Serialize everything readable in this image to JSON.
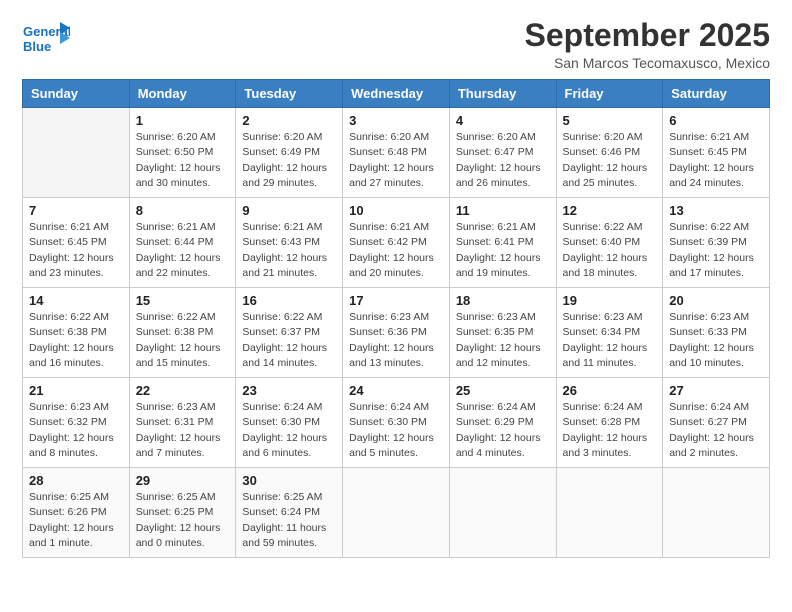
{
  "header": {
    "logo_line1": "General",
    "logo_line2": "Blue",
    "title": "September 2025",
    "subtitle": "San Marcos Tecomaxusco, Mexico"
  },
  "days_of_week": [
    "Sunday",
    "Monday",
    "Tuesday",
    "Wednesday",
    "Thursday",
    "Friday",
    "Saturday"
  ],
  "weeks": [
    [
      {
        "day": "",
        "info": ""
      },
      {
        "day": "1",
        "info": "Sunrise: 6:20 AM\nSunset: 6:50 PM\nDaylight: 12 hours\nand 30 minutes."
      },
      {
        "day": "2",
        "info": "Sunrise: 6:20 AM\nSunset: 6:49 PM\nDaylight: 12 hours\nand 29 minutes."
      },
      {
        "day": "3",
        "info": "Sunrise: 6:20 AM\nSunset: 6:48 PM\nDaylight: 12 hours\nand 27 minutes."
      },
      {
        "day": "4",
        "info": "Sunrise: 6:20 AM\nSunset: 6:47 PM\nDaylight: 12 hours\nand 26 minutes."
      },
      {
        "day": "5",
        "info": "Sunrise: 6:20 AM\nSunset: 6:46 PM\nDaylight: 12 hours\nand 25 minutes."
      },
      {
        "day": "6",
        "info": "Sunrise: 6:21 AM\nSunset: 6:45 PM\nDaylight: 12 hours\nand 24 minutes."
      }
    ],
    [
      {
        "day": "7",
        "info": "Sunrise: 6:21 AM\nSunset: 6:45 PM\nDaylight: 12 hours\nand 23 minutes."
      },
      {
        "day": "8",
        "info": "Sunrise: 6:21 AM\nSunset: 6:44 PM\nDaylight: 12 hours\nand 22 minutes."
      },
      {
        "day": "9",
        "info": "Sunrise: 6:21 AM\nSunset: 6:43 PM\nDaylight: 12 hours\nand 21 minutes."
      },
      {
        "day": "10",
        "info": "Sunrise: 6:21 AM\nSunset: 6:42 PM\nDaylight: 12 hours\nand 20 minutes."
      },
      {
        "day": "11",
        "info": "Sunrise: 6:21 AM\nSunset: 6:41 PM\nDaylight: 12 hours\nand 19 minutes."
      },
      {
        "day": "12",
        "info": "Sunrise: 6:22 AM\nSunset: 6:40 PM\nDaylight: 12 hours\nand 18 minutes."
      },
      {
        "day": "13",
        "info": "Sunrise: 6:22 AM\nSunset: 6:39 PM\nDaylight: 12 hours\nand 17 minutes."
      }
    ],
    [
      {
        "day": "14",
        "info": "Sunrise: 6:22 AM\nSunset: 6:38 PM\nDaylight: 12 hours\nand 16 minutes."
      },
      {
        "day": "15",
        "info": "Sunrise: 6:22 AM\nSunset: 6:38 PM\nDaylight: 12 hours\nand 15 minutes."
      },
      {
        "day": "16",
        "info": "Sunrise: 6:22 AM\nSunset: 6:37 PM\nDaylight: 12 hours\nand 14 minutes."
      },
      {
        "day": "17",
        "info": "Sunrise: 6:23 AM\nSunset: 6:36 PM\nDaylight: 12 hours\nand 13 minutes."
      },
      {
        "day": "18",
        "info": "Sunrise: 6:23 AM\nSunset: 6:35 PM\nDaylight: 12 hours\nand 12 minutes."
      },
      {
        "day": "19",
        "info": "Sunrise: 6:23 AM\nSunset: 6:34 PM\nDaylight: 12 hours\nand 11 minutes."
      },
      {
        "day": "20",
        "info": "Sunrise: 6:23 AM\nSunset: 6:33 PM\nDaylight: 12 hours\nand 10 minutes."
      }
    ],
    [
      {
        "day": "21",
        "info": "Sunrise: 6:23 AM\nSunset: 6:32 PM\nDaylight: 12 hours\nand 8 minutes."
      },
      {
        "day": "22",
        "info": "Sunrise: 6:23 AM\nSunset: 6:31 PM\nDaylight: 12 hours\nand 7 minutes."
      },
      {
        "day": "23",
        "info": "Sunrise: 6:24 AM\nSunset: 6:30 PM\nDaylight: 12 hours\nand 6 minutes."
      },
      {
        "day": "24",
        "info": "Sunrise: 6:24 AM\nSunset: 6:30 PM\nDaylight: 12 hours\nand 5 minutes."
      },
      {
        "day": "25",
        "info": "Sunrise: 6:24 AM\nSunset: 6:29 PM\nDaylight: 12 hours\nand 4 minutes."
      },
      {
        "day": "26",
        "info": "Sunrise: 6:24 AM\nSunset: 6:28 PM\nDaylight: 12 hours\nand 3 minutes."
      },
      {
        "day": "27",
        "info": "Sunrise: 6:24 AM\nSunset: 6:27 PM\nDaylight: 12 hours\nand 2 minutes."
      }
    ],
    [
      {
        "day": "28",
        "info": "Sunrise: 6:25 AM\nSunset: 6:26 PM\nDaylight: 12 hours\nand 1 minute."
      },
      {
        "day": "29",
        "info": "Sunrise: 6:25 AM\nSunset: 6:25 PM\nDaylight: 12 hours\nand 0 minutes."
      },
      {
        "day": "30",
        "info": "Sunrise: 6:25 AM\nSunset: 6:24 PM\nDaylight: 11 hours\nand 59 minutes."
      },
      {
        "day": "",
        "info": ""
      },
      {
        "day": "",
        "info": ""
      },
      {
        "day": "",
        "info": ""
      },
      {
        "day": "",
        "info": ""
      }
    ]
  ]
}
